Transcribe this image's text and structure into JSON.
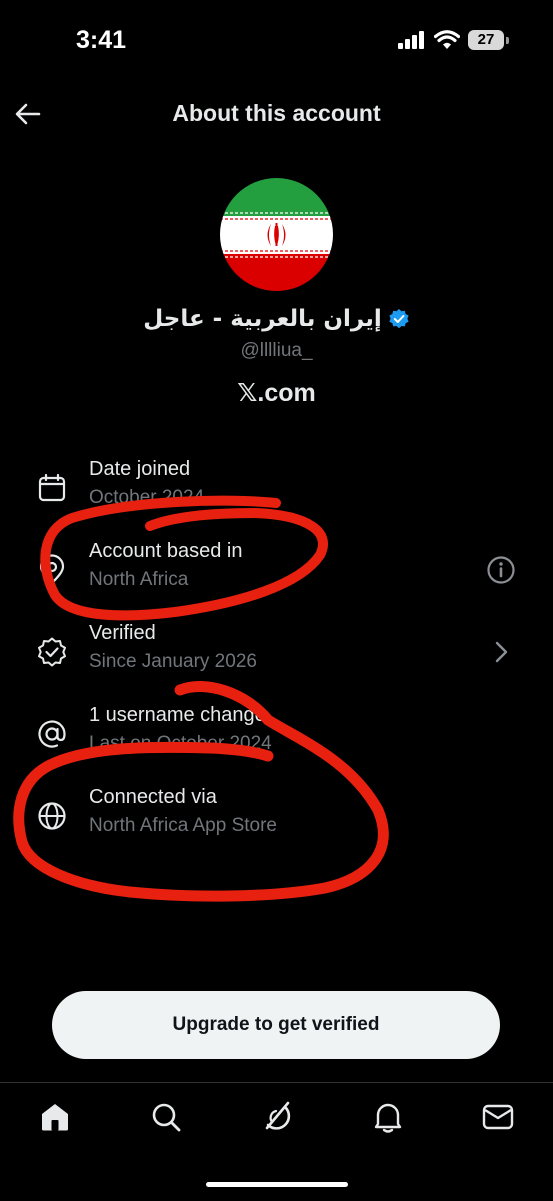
{
  "status_bar": {
    "time": "3:41",
    "battery": "27"
  },
  "header": {
    "title": "About this account"
  },
  "profile": {
    "display_name": "إيران بالعربية - عاجل",
    "handle": "@lllliua_",
    "domain": "𝕏.com",
    "verified": true
  },
  "rows": [
    {
      "title": "Date joined",
      "subtitle": "October 2024",
      "icon": "calendar-icon"
    },
    {
      "title": "Account based in",
      "subtitle": "North Africa",
      "icon": "location-pin-icon",
      "action_icon": "info-icon"
    },
    {
      "title": "Verified",
      "subtitle": "Since January 2026",
      "icon": "verified-badge-icon",
      "action_icon": "chevron-right-icon"
    },
    {
      "title": "1 username change",
      "subtitle": "Last on October 2024",
      "icon": "at-sign-icon"
    },
    {
      "title": "Connected via",
      "subtitle": "North Africa App Store",
      "icon": "globe-icon"
    }
  ],
  "cta": {
    "label": "Upgrade to get verified"
  },
  "tab_bar": {
    "tabs": [
      "home-icon",
      "search-icon",
      "grok-icon",
      "notifications-icon",
      "messages-icon"
    ]
  },
  "colors": {
    "background": "#000000",
    "verified_blue": "#1d9bf0",
    "annotation_red": "#e8200f",
    "muted_text": "#71767b"
  }
}
